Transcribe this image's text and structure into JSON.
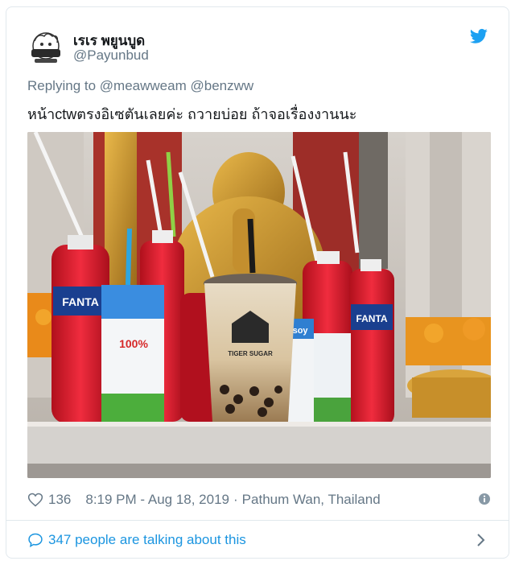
{
  "tweet": {
    "display_name": "เรเร พยูนบูด",
    "handle": "@Payunbud",
    "replying_prefix": "Replying to",
    "reply_mentions": [
      "@meawweam",
      "@benzww"
    ],
    "text": "หน้าctwตรงอิเซตันเลยค่ะ  ถวายบ่อย ถ้าจอเรื่องงานนะ",
    "photo_labels": {
      "fanta_left": "FANTA",
      "fanta_right": "FANTA",
      "tiger_sugar": "TIGER SUGAR",
      "vitamilk": "100%",
      "lasoy": "asoy"
    },
    "likes": "136",
    "timestamp": "8:19 PM - Aug 18, 2019",
    "location": "Pathum Wan, Thailand",
    "separator": "·",
    "talking": "347 people are talking about this"
  },
  "colors": {
    "twitter_blue": "#1da1f2",
    "link_blue": "#1b95e0",
    "secondary_text": "#657786",
    "border": "#e1e8ed"
  },
  "icons": {
    "brand": "twitter-bird-icon",
    "like": "heart-icon",
    "info": "info-icon",
    "conversation": "speech-bubble-icon",
    "navigate": "chevron-right-icon"
  }
}
